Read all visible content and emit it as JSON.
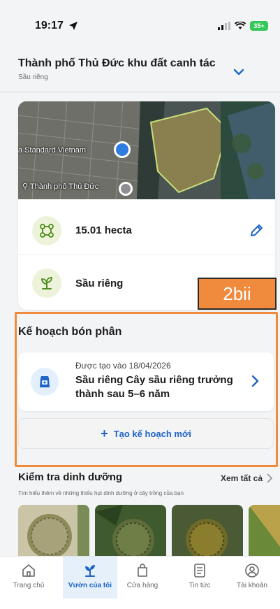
{
  "status_bar": {
    "time": "19:17",
    "battery": "35+"
  },
  "header": {
    "farm_name": "Thành phố Thủ Đức khu đất canh tác",
    "crop": "Sầu riêng"
  },
  "map": {
    "label_1": "a Standard Vietnam",
    "label_2": "Thành phố Thủ Đức"
  },
  "field": {
    "area": "15.01 hecta",
    "crop_name": "Sầu riêng"
  },
  "annotation": {
    "tag": "2bii",
    "color": "#f08a3c"
  },
  "fertilizer_plan": {
    "title": "Kế hoạch bón phân",
    "plan": {
      "created": "Được tạo vào 18/04/2026",
      "name": "Sầu riêng Cây sầu riêng trưởng thành sau 5–6 năm"
    },
    "new_plan_label": "Tạo kế hoạch mới"
  },
  "nutrition": {
    "title": "Kiểm tra dinh dưỡng",
    "see_all": "Xem tất cả",
    "subtitle": "Tìm hiểu thêm về những thiếu hụt dinh dưỡng ở cây trồng của bạn"
  },
  "bottom_nav": {
    "items": [
      {
        "label": "Trang chủ",
        "icon": "home-icon"
      },
      {
        "label": "Vườn của tôi",
        "icon": "sprout-icon",
        "active": true
      },
      {
        "label": "Cửa hàng",
        "icon": "shopping-bag-icon"
      },
      {
        "label": "Tin tức",
        "icon": "news-icon"
      },
      {
        "label": "Tài khoản",
        "icon": "account-icon"
      }
    ]
  },
  "colors": {
    "accent": "#1e63c7",
    "highlight": "#f08a3c",
    "icon_bg_green": "#ecf3da"
  }
}
